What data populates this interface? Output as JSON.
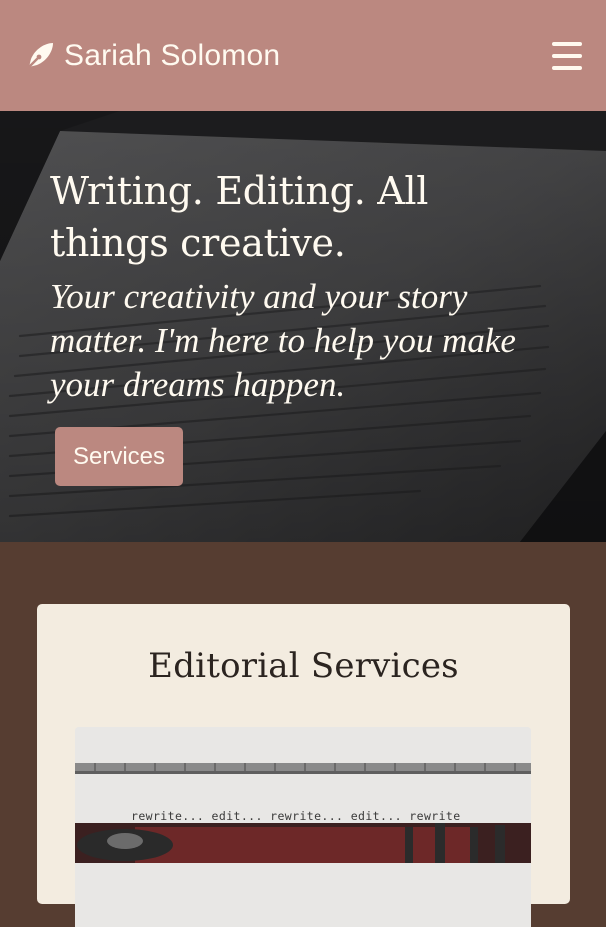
{
  "navbar": {
    "brand_name": "Sariah Solomon",
    "brand_icon": "feather-pen-icon",
    "menu_icon": "hamburger-menu-icon",
    "background_color": "#bb8880"
  },
  "hero": {
    "title": "Writing. Editing. All things creative.",
    "tagline": "Your creativity and your story matter. I'm here to help you make your dreams happen.",
    "cta_label": "Services"
  },
  "services_card": {
    "title": "Editorial Services",
    "image_text": "rewrite... edit... rewrite... edit... rewrite"
  },
  "colors": {
    "accent": "#bb8880",
    "page_background": "#563d31",
    "card_background": "#f3ece0",
    "text_light": "#fffaf0"
  }
}
